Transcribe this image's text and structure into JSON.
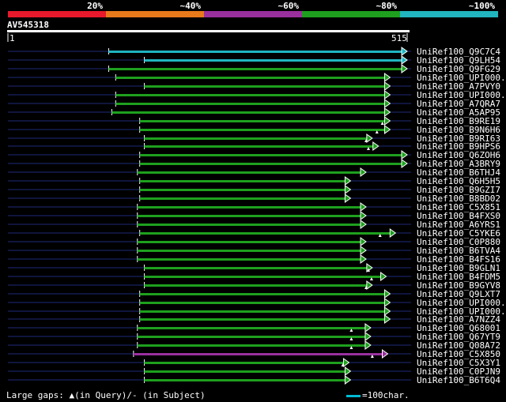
{
  "identity_scale": {
    "labels": [
      "20%",
      "~40%",
      "~60%",
      "~80%",
      "~100%"
    ],
    "colors": [
      "#e8192c",
      "#e87a1c",
      "#9a2f9e",
      "#1ea01e",
      "#20b5c0"
    ]
  },
  "query": {
    "name": "AV545318",
    "start": "1",
    "end": "515",
    "length": 515
  },
  "alignments": [
    {
      "label": "UniRef100_Q9C7C4",
      "qs": 130,
      "qe": 515,
      "color": "#20b5c0",
      "gaps": []
    },
    {
      "label": "UniRef100_Q9LH54",
      "qs": 176,
      "qe": 515,
      "color": "#20b5c0",
      "gaps": []
    },
    {
      "label": "UniRef100_Q9FG29",
      "qs": 130,
      "qe": 515,
      "color": "#1ea01e",
      "gaps": []
    },
    {
      "label": "UniRef100_UPI000..",
      "qs": 139,
      "qe": 493,
      "color": "#1ea01e",
      "gaps": []
    },
    {
      "label": "UniRef100_A7PVY0",
      "qs": 176,
      "qe": 493,
      "color": "#1ea01e",
      "gaps": []
    },
    {
      "label": "UniRef100_UPI000..",
      "qs": 139,
      "qe": 493,
      "color": "#1ea01e",
      "gaps": []
    },
    {
      "label": "UniRef100_A7QRA7",
      "qs": 139,
      "qe": 493,
      "color": "#1ea01e",
      "gaps": []
    },
    {
      "label": "UniRef100_A5AP95",
      "qs": 134,
      "qe": 493,
      "color": "#1ea01e",
      "gaps": []
    },
    {
      "label": "UniRef100_B9RE19",
      "qs": 170,
      "qe": 493,
      "color": "#1ea01e",
      "gaps": [
        {
          "pos": 483,
          "type": "query"
        }
      ]
    },
    {
      "label": "UniRef100_B9N6H6",
      "qs": 170,
      "qe": 493,
      "color": "#1ea01e",
      "gaps": [
        {
          "pos": 476,
          "type": "query"
        }
      ]
    },
    {
      "label": "UniRef100_B9RI63",
      "qs": 176,
      "qe": 470,
      "color": "#1ea01e",
      "gaps": [
        {
          "pos": 462,
          "type": "query"
        }
      ]
    },
    {
      "label": "UniRef100_B9HPS6",
      "qs": 176,
      "qe": 478,
      "color": "#1ea01e",
      "gaps": [
        {
          "pos": 465,
          "type": "query"
        }
      ]
    },
    {
      "label": "UniRef100_Q6ZOH6",
      "qs": 170,
      "qe": 515,
      "color": "#1ea01e",
      "gaps": []
    },
    {
      "label": "UniRef100_A3BRY9",
      "qs": 170,
      "qe": 515,
      "color": "#1ea01e",
      "gaps": []
    },
    {
      "label": "UniRef100_B6THJ4",
      "qs": 167,
      "qe": 462,
      "color": "#1ea01e",
      "gaps": []
    },
    {
      "label": "UniRef100_Q6H5H5",
      "qs": 170,
      "qe": 442,
      "color": "#1ea01e",
      "gaps": []
    },
    {
      "label": "UniRef100_B9GZI7",
      "qs": 170,
      "qe": 442,
      "color": "#1ea01e",
      "gaps": []
    },
    {
      "label": "UniRef100_B8BD02",
      "qs": 170,
      "qe": 442,
      "color": "#1ea01e",
      "gaps": []
    },
    {
      "label": "UniRef100_C5X851",
      "qs": 167,
      "qe": 462,
      "color": "#1ea01e",
      "gaps": []
    },
    {
      "label": "UniRef100_B4FXS0",
      "qs": 167,
      "qe": 462,
      "color": "#1ea01e",
      "gaps": []
    },
    {
      "label": "UniRef100_A6YRS1",
      "qs": 167,
      "qe": 462,
      "color": "#1ea01e",
      "gaps": []
    },
    {
      "label": "UniRef100_C5YKE6",
      "qs": 170,
      "qe": 500,
      "color": "#1ea01e",
      "gaps": [
        {
          "pos": 480,
          "type": "query"
        }
      ]
    },
    {
      "label": "UniRef100_C0P880",
      "qs": 167,
      "qe": 462,
      "color": "#1ea01e",
      "gaps": []
    },
    {
      "label": "UniRef100_B6TVA4",
      "qs": 167,
      "qe": 462,
      "color": "#1ea01e",
      "gaps": []
    },
    {
      "label": "UniRef100_B4FS16",
      "qs": 167,
      "qe": 462,
      "color": "#1ea01e",
      "gaps": []
    },
    {
      "label": "UniRef100_B9GLN1",
      "qs": 176,
      "qe": 470,
      "color": "#1ea01e",
      "gaps": [
        {
          "pos": 465,
          "type": "query"
        }
      ]
    },
    {
      "label": "UniRef100_B4FDM5",
      "qs": 176,
      "qe": 488,
      "color": "#1ea01e",
      "gaps": [
        {
          "pos": 469,
          "type": "query"
        }
      ]
    },
    {
      "label": "UniRef100_B9GYV8",
      "qs": 176,
      "qe": 470,
      "color": "#1ea01e",
      "gaps": [
        {
          "pos": 462,
          "type": "query"
        }
      ]
    },
    {
      "label": "UniRef100_Q9LXT7",
      "qs": 170,
      "qe": 493,
      "color": "#1ea01e",
      "gaps": []
    },
    {
      "label": "UniRef100_UPI000..",
      "qs": 170,
      "qe": 493,
      "color": "#1ea01e",
      "gaps": []
    },
    {
      "label": "UniRef100_UPI000..",
      "qs": 170,
      "qe": 493,
      "color": "#1ea01e",
      "gaps": []
    },
    {
      "label": "UniRef100_A7NZZ4",
      "qs": 170,
      "qe": 493,
      "color": "#1ea01e",
      "gaps": []
    },
    {
      "label": "UniRef100_Q68001",
      "qs": 167,
      "qe": 468,
      "color": "#1ea01e",
      "gaps": [
        {
          "pos": 443,
          "type": "query"
        }
      ]
    },
    {
      "label": "UniRef100_Q67YT9",
      "qs": 167,
      "qe": 468,
      "color": "#1ea01e",
      "gaps": [
        {
          "pos": 443,
          "type": "query"
        }
      ]
    },
    {
      "label": "UniRef100_Q08A72",
      "qs": 167,
      "qe": 468,
      "color": "#1ea01e",
      "gaps": [
        {
          "pos": 443,
          "type": "query"
        }
      ]
    },
    {
      "label": "UniRef100_C5X850",
      "qs": 162,
      "qe": 490,
      "color": "#9a2f9e",
      "gaps": [
        {
          "pos": 470,
          "type": "query"
        }
      ]
    },
    {
      "label": "UniRef100_C5X3Y1",
      "qs": 176,
      "qe": 440,
      "color": "#1ea01e",
      "gaps": [
        {
          "pos": 432,
          "type": "query"
        }
      ]
    },
    {
      "label": "UniRef100_C0PJN9",
      "qs": 176,
      "qe": 442,
      "color": "#1ea01e",
      "gaps": []
    },
    {
      "label": "UniRef100_B6T6Q4",
      "qs": 176,
      "qe": 442,
      "color": "#1ea01e",
      "gaps": []
    }
  ],
  "footer": {
    "gaps_text": "Large gaps: ▲(in Query)/- (in Subject)",
    "legend_text": "=100char.",
    "legend_color": "#00bcd4"
  }
}
